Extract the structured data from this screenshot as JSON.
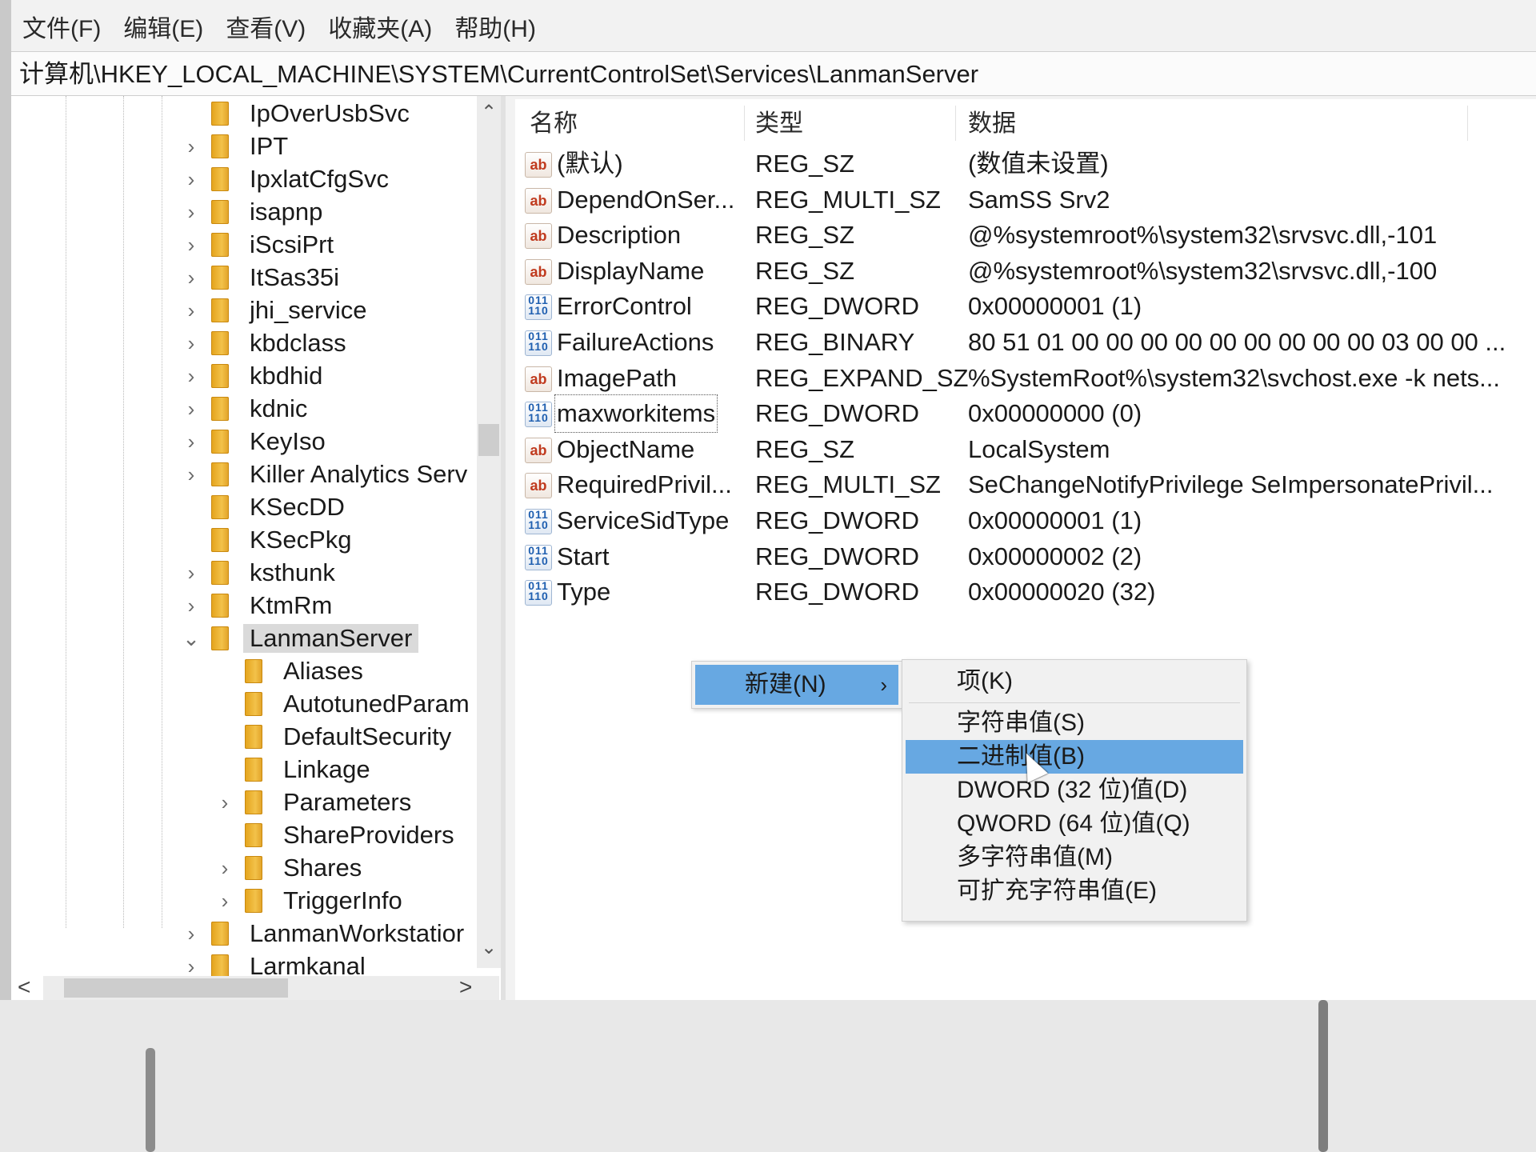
{
  "menu": [
    "文件(F)",
    "编辑(E)",
    "查看(V)",
    "收藏夹(A)",
    "帮助(H)"
  ],
  "address_path": "计算机\\HKEY_LOCAL_MACHINE\\SYSTEM\\CurrentControlSet\\Services\\LanmanServer",
  "tree": [
    {
      "label": "IpOverUsbSvc",
      "expander": "",
      "level": 0
    },
    {
      "label": "IPT",
      "expander": "›",
      "level": 0
    },
    {
      "label": "IpxlatCfgSvc",
      "expander": "›",
      "level": 0
    },
    {
      "label": "isapnp",
      "expander": "›",
      "level": 0
    },
    {
      "label": "iScsiPrt",
      "expander": "›",
      "level": 0
    },
    {
      "label": "ItSas35i",
      "expander": "›",
      "level": 0
    },
    {
      "label": "jhi_service",
      "expander": "›",
      "level": 0
    },
    {
      "label": "kbdclass",
      "expander": "›",
      "level": 0
    },
    {
      "label": "kbdhid",
      "expander": "›",
      "level": 0
    },
    {
      "label": "kdnic",
      "expander": "›",
      "level": 0
    },
    {
      "label": "KeyIso",
      "expander": "›",
      "level": 0
    },
    {
      "label": "Killer Analytics Serv",
      "expander": "›",
      "level": 0
    },
    {
      "label": "KSecDD",
      "expander": "",
      "level": 0
    },
    {
      "label": "KSecPkg",
      "expander": "",
      "level": 0
    },
    {
      "label": "ksthunk",
      "expander": "›",
      "level": 0
    },
    {
      "label": "KtmRm",
      "expander": "›",
      "level": 0
    },
    {
      "label": "LanmanServer",
      "expander": "⌄",
      "level": 0,
      "selected": true
    },
    {
      "label": "Aliases",
      "expander": "",
      "level": 1
    },
    {
      "label": "AutotunedParam",
      "expander": "",
      "level": 1
    },
    {
      "label": "DefaultSecurity",
      "expander": "",
      "level": 1
    },
    {
      "label": "Linkage",
      "expander": "",
      "level": 1
    },
    {
      "label": "Parameters",
      "expander": "›",
      "level": 1
    },
    {
      "label": "ShareProviders",
      "expander": "",
      "level": 1
    },
    {
      "label": "Shares",
      "expander": "›",
      "level": 1
    },
    {
      "label": "TriggerInfo",
      "expander": "›",
      "level": 1
    },
    {
      "label": "LanmanWorkstatior",
      "expander": "›",
      "level": 0
    },
    {
      "label": "Larmkanal",
      "expander": "›",
      "level": 0
    }
  ],
  "scroll": {
    "up": "⌃",
    "down": "⌄",
    "left": "<",
    "right": ">"
  },
  "columns": {
    "name": "名称",
    "type": "类型",
    "data": "数据"
  },
  "values": [
    {
      "icon": "ab",
      "name": "(默认)",
      "type": "REG_SZ",
      "data": "(数值未设置)"
    },
    {
      "icon": "ab",
      "name": "DependOnSer...",
      "type": "REG_MULTI_SZ",
      "data": "SamSS Srv2"
    },
    {
      "icon": "ab",
      "name": "Description",
      "type": "REG_SZ",
      "data": "@%systemroot%\\system32\\srvsvc.dll,-101"
    },
    {
      "icon": "ab",
      "name": "DisplayName",
      "type": "REG_SZ",
      "data": "@%systemroot%\\system32\\srvsvc.dll,-100"
    },
    {
      "icon": "bin",
      "name": "ErrorControl",
      "type": "REG_DWORD",
      "data": "0x00000001 (1)"
    },
    {
      "icon": "bin",
      "name": "FailureActions",
      "type": "REG_BINARY",
      "data": "80 51 01 00 00 00 00 00 00 00 00 00 03 00 00 ..."
    },
    {
      "icon": "ab",
      "name": "ImagePath",
      "type": "REG_EXPAND_SZ",
      "data": "%SystemRoot%\\system32\\svchost.exe -k nets..."
    },
    {
      "icon": "bin",
      "name": "maxworkitems",
      "type": "REG_DWORD",
      "data": "0x00000000 (0)",
      "focused": true
    },
    {
      "icon": "ab",
      "name": "ObjectName",
      "type": "REG_SZ",
      "data": "LocalSystem"
    },
    {
      "icon": "ab",
      "name": "RequiredPrivil...",
      "type": "REG_MULTI_SZ",
      "data": "SeChangeNotifyPrivilege SeImpersonatePrivil..."
    },
    {
      "icon": "bin",
      "name": "ServiceSidType",
      "type": "REG_DWORD",
      "data": "0x00000001 (1)"
    },
    {
      "icon": "bin",
      "name": "Start",
      "type": "REG_DWORD",
      "data": "0x00000002 (2)"
    },
    {
      "icon": "bin",
      "name": "Type",
      "type": "REG_DWORD",
      "data": "0x00000020 (32)"
    }
  ],
  "context_menu": {
    "new_label": "新建(N)",
    "arrow": "›"
  },
  "submenu": [
    "项(K)",
    "字符串值(S)",
    "二进制值(B)",
    "DWORD (32 位)值(D)",
    "QWORD (64 位)值(Q)",
    "多字符串值(M)",
    "可扩充字符串值(E)"
  ],
  "submenu_highlight_index": 2,
  "colors": {
    "menu_highlight": "#67a8e2",
    "folder": "#f0b93a",
    "selection": "#dadada"
  }
}
